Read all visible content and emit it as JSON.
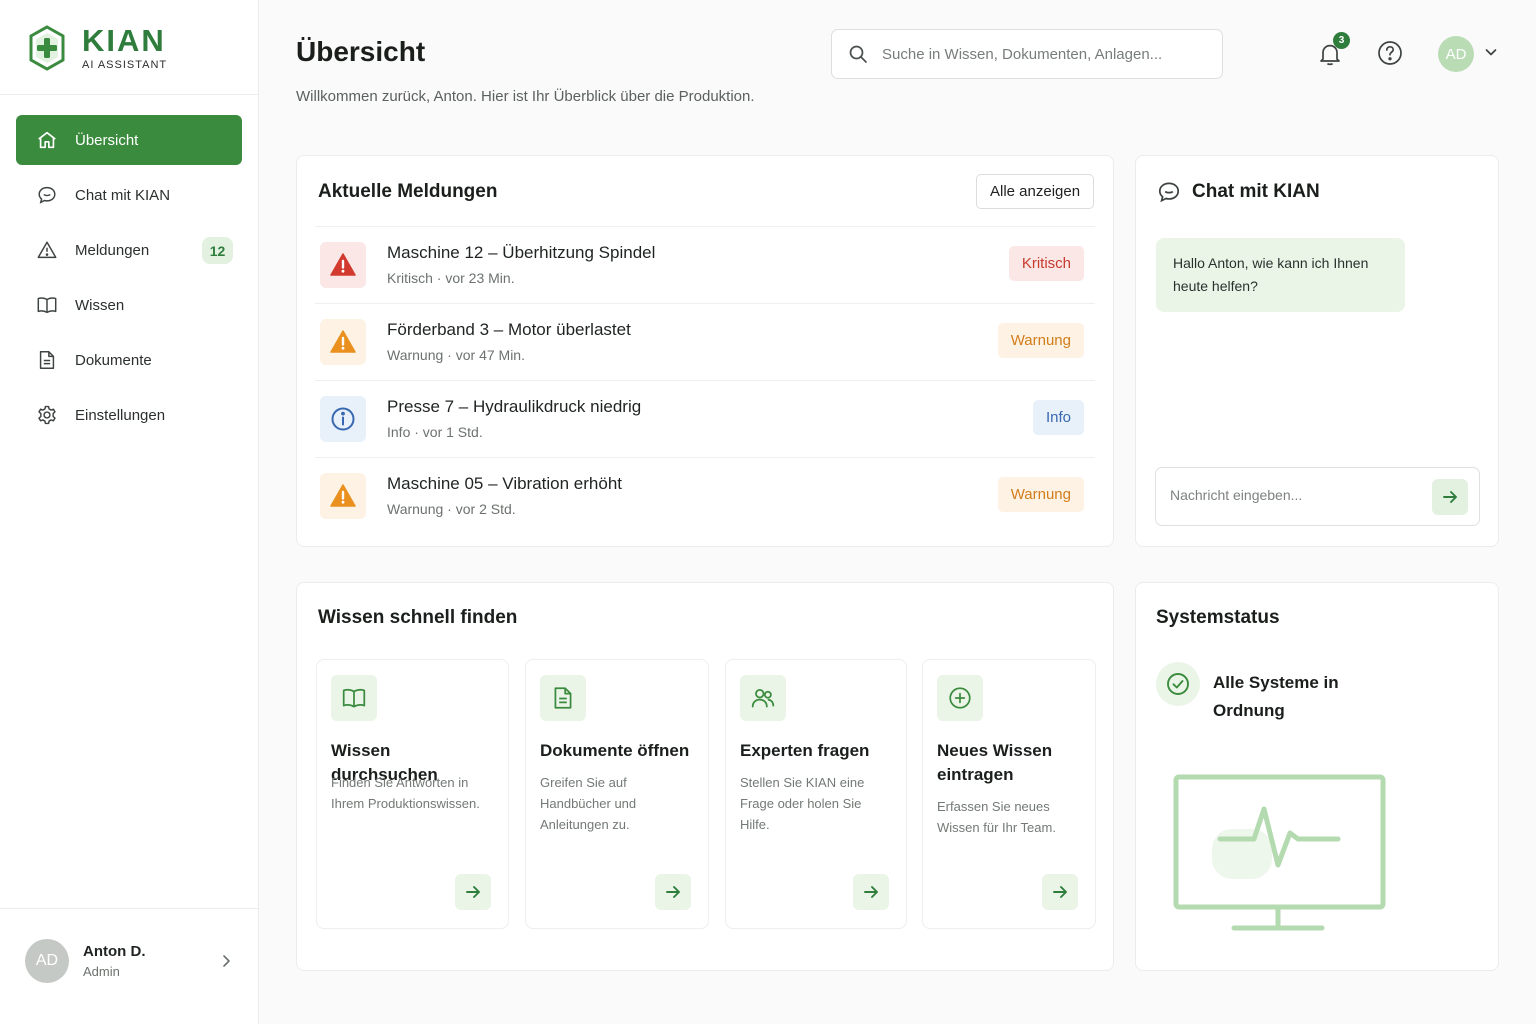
{
  "brand": {
    "name": "KIAN",
    "tagline": "AI ASSISTANT",
    "accent": "#3b8b3f"
  },
  "sidebar": {
    "items": [
      {
        "label": "Übersicht",
        "icon": "home-icon",
        "active": true
      },
      {
        "label": "Chat mit KIAN",
        "icon": "chat-icon"
      },
      {
        "label": "Meldungen",
        "icon": "warning-icon",
        "badge": "12"
      },
      {
        "label": "Wissen",
        "icon": "book-icon"
      },
      {
        "label": "Dokumente",
        "icon": "document-icon"
      },
      {
        "label": "Einstellungen",
        "icon": "gear-icon"
      }
    ],
    "user": {
      "initials": "AD",
      "name": "Anton D.",
      "role": "Admin"
    }
  },
  "header": {
    "title": "Übersicht",
    "subtitle": "Willkommen zurück, Anton. Hier ist Ihr Überblick über die Produktion.",
    "search_placeholder": "Suche in Wissen, Dokumenten, Anlagen...",
    "notification_count": "3",
    "avatar_initials": "AD"
  },
  "alerts": {
    "title": "Aktuelle Meldungen",
    "show_all": "Alle anzeigen",
    "items": [
      {
        "title": "Maschine 12 – Überhitzung Spindel",
        "meta": "Kritisch · vor 23 Min.",
        "tag": "Kritisch",
        "level": "critical"
      },
      {
        "title": "Förderband 3 – Motor überlastet",
        "meta": "Warnung · vor 47 Min.",
        "tag": "Warnung",
        "level": "warning"
      },
      {
        "title": "Presse 7 – Hydraulikdruck niedrig",
        "meta": "Info · vor 1 Std.",
        "tag": "Info",
        "level": "info"
      },
      {
        "title": "Maschine 05 – Vibration erhöht",
        "meta": "Warnung · vor 2 Std.",
        "tag": "Warnung",
        "level": "warning"
      }
    ]
  },
  "chat": {
    "title": "Chat mit KIAN",
    "greeting": "Hallo Anton, wie kann ich Ihnen heute helfen?",
    "input_placeholder": "Nachricht eingeben..."
  },
  "knowledge": {
    "title": "Wissen schnell finden",
    "cards": [
      {
        "title": "Wissen durchsuchen",
        "description": "Finden Sie Antworten in Ihrem Produktionswissen.",
        "icon": "book-icon"
      },
      {
        "title": "Dokumente öffnen",
        "description": "Greifen Sie auf Handbücher und Anleitungen zu.",
        "icon": "document-icon"
      },
      {
        "title": "Experten fragen",
        "description": "Stellen Sie KIAN eine Frage oder holen Sie Hilfe.",
        "icon": "users-icon"
      },
      {
        "title": "Neues Wissen eintragen",
        "description": "Erfassen Sie neues Wissen für Ihr Team.",
        "icon": "plus-circle-icon"
      }
    ]
  },
  "system_status": {
    "title": "Systemstatus",
    "status": "Alle Systeme in Ordnung",
    "icon": "check-circle-icon",
    "illustration": "monitor-heartbeat-icon"
  }
}
